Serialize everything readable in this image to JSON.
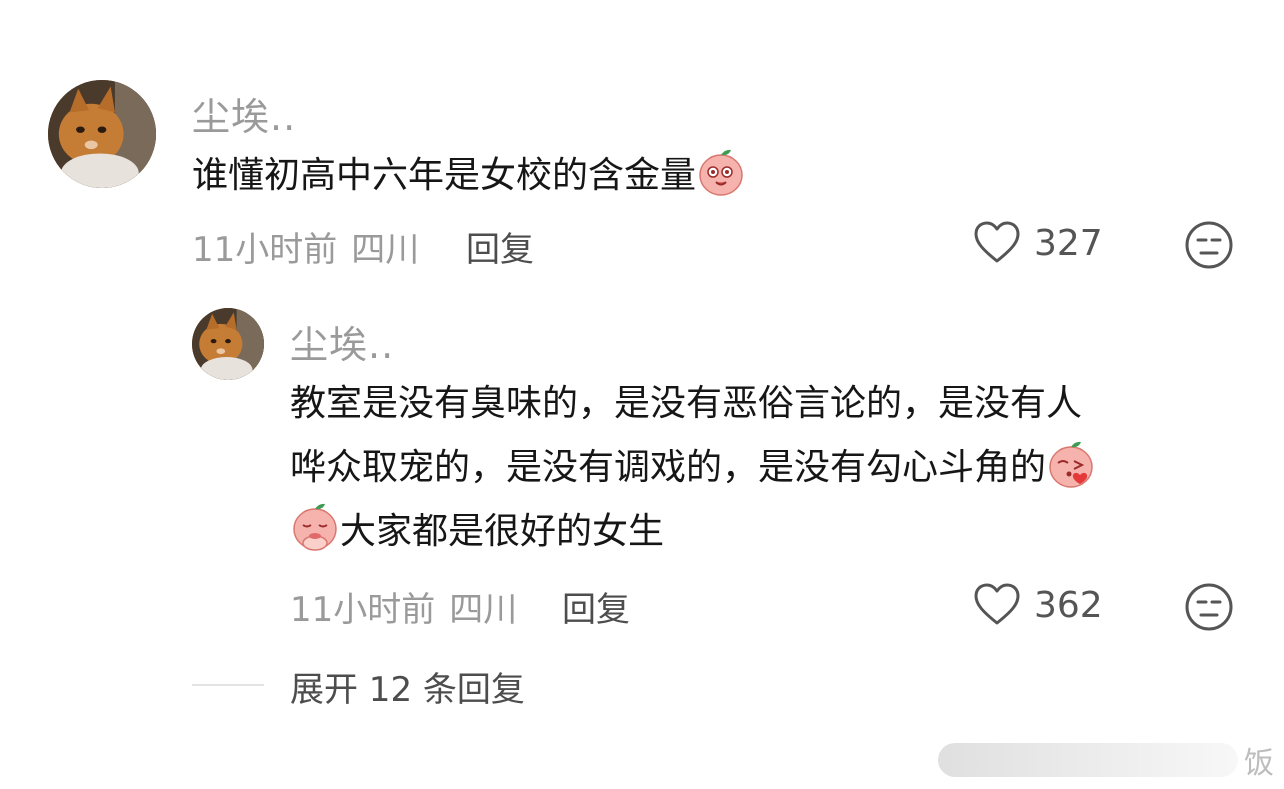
{
  "comment": {
    "username": "尘埃..",
    "text": "谁懂初高中六年是女校的含金量",
    "time": "11小时前",
    "location": "四川",
    "reply_label": "回复",
    "likes": "327",
    "avatar_icon": "cat-avatar-icon",
    "emoji_icon": "peach-shy-emoji-icon"
  },
  "reply": {
    "username": "尘埃..",
    "text_line1": "教室是没有臭味的，是没有恶俗言论的，是没有人",
    "text_line2": "哗众取宠的，是没有调戏的，是没有勾心斗角的",
    "text_line3": "大家都是很好的女生",
    "time": "11小时前",
    "location": "四川",
    "reply_label": "回复",
    "likes": "362",
    "avatar_icon": "cat-avatar-icon",
    "emoji_icons": [
      "peach-kiss-emoji-icon",
      "peach-pray-emoji-icon"
    ]
  },
  "expand": {
    "label": "展开 12 条回复"
  },
  "watermark": {
    "text": "饭"
  },
  "colors": {
    "text": "#161616",
    "muted": "#9a9a9a",
    "secondary": "#4d4d4d",
    "emoji_pink": "#f6b3ad",
    "emoji_leaf": "#3e9c52"
  }
}
